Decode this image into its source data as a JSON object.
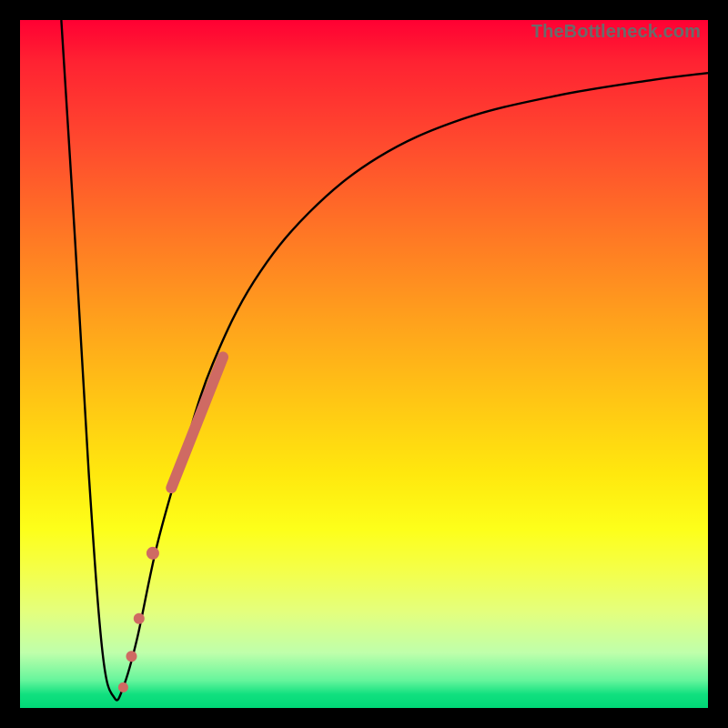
{
  "watermark": "TheBottleneck.com",
  "colors": {
    "frame": "#000000",
    "curve": "#000000",
    "marker": "#cf6a63"
  },
  "chart_data": {
    "type": "line",
    "title": "",
    "xlabel": "",
    "ylabel": "",
    "xlim": [
      0,
      100
    ],
    "ylim": [
      0,
      100
    ],
    "legend": false,
    "grid": false,
    "series": [
      {
        "name": "bottleneck-curve",
        "x": [
          6,
          8,
          10,
          12,
          13.7,
          15,
          17,
          20,
          24,
          28,
          34,
          42,
          52,
          64,
          78,
          92,
          100
        ],
        "y": [
          100,
          68,
          34,
          8,
          1.5,
          3,
          10,
          24,
          38,
          50,
          62,
          72,
          80,
          85.5,
          89,
          91.3,
          92.3
        ]
      }
    ],
    "markers": [
      {
        "name": "highlight-band-top",
        "shape": "capsule",
        "x1": 22.0,
        "y1": 32.0,
        "x2": 29.5,
        "y2": 51.0,
        "width": 12
      },
      {
        "name": "highlight-dot-1",
        "shape": "circle",
        "x": 19.3,
        "y": 22.5,
        "r": 7
      },
      {
        "name": "highlight-dot-2",
        "shape": "circle",
        "x": 17.3,
        "y": 13.0,
        "r": 6
      },
      {
        "name": "highlight-dot-3",
        "shape": "circle",
        "x": 16.2,
        "y": 7.5,
        "r": 6
      },
      {
        "name": "highlight-dot-bottom",
        "shape": "circle",
        "x": 15.0,
        "y": 3.0,
        "r": 5.5
      }
    ]
  }
}
